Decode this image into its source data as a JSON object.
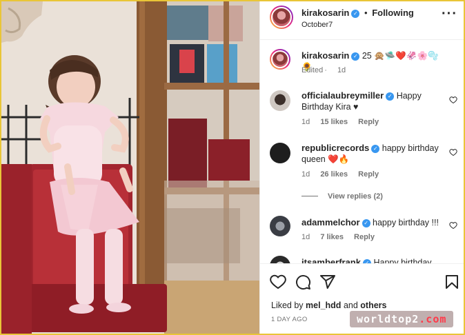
{
  "post": {
    "author": "kirakosarin",
    "follow_separator": "•",
    "follow_label": "Following",
    "subtitle": "October7",
    "more_icon": "more-horizontal-icon"
  },
  "caption": {
    "author": "kirakosarin",
    "text": "25 🙊🛸❤️🦑🌸🫧🌻",
    "edited": "Edited",
    "time": "1d"
  },
  "comments": [
    {
      "user": "officialaubreymiller",
      "text": "Happy Birthday Kira ♥",
      "time": "1d",
      "likes": "15 likes",
      "reply": "Reply"
    },
    {
      "user": "republicrecords",
      "text": "happy birthday queen ❤️🔥",
      "time": "1d",
      "likes": "26 likes",
      "reply": "Reply",
      "view_replies": "View replies (2)"
    },
    {
      "user": "adammelchor",
      "text": "happy birthday !!!",
      "time": "1d",
      "likes": "7 likes",
      "reply": "Reply"
    },
    {
      "user": "itsamberfrank",
      "text": "Happy birthday"
    }
  ],
  "actions": {
    "like_icon": "heart-icon",
    "comment_icon": "comment-icon",
    "share_icon": "share-icon",
    "save_icon": "bookmark-icon"
  },
  "likes_line": {
    "prefix": "Liked by",
    "user": "mel_hdd",
    "and": "and",
    "others": "others"
  },
  "date": "1 DAY AGO",
  "watermark": {
    "name": "worldtop2",
    "tld": ".com"
  },
  "colors": {
    "verified": "#3897f0",
    "muted": "#737373",
    "text": "#262626",
    "border": "#e9c537"
  }
}
